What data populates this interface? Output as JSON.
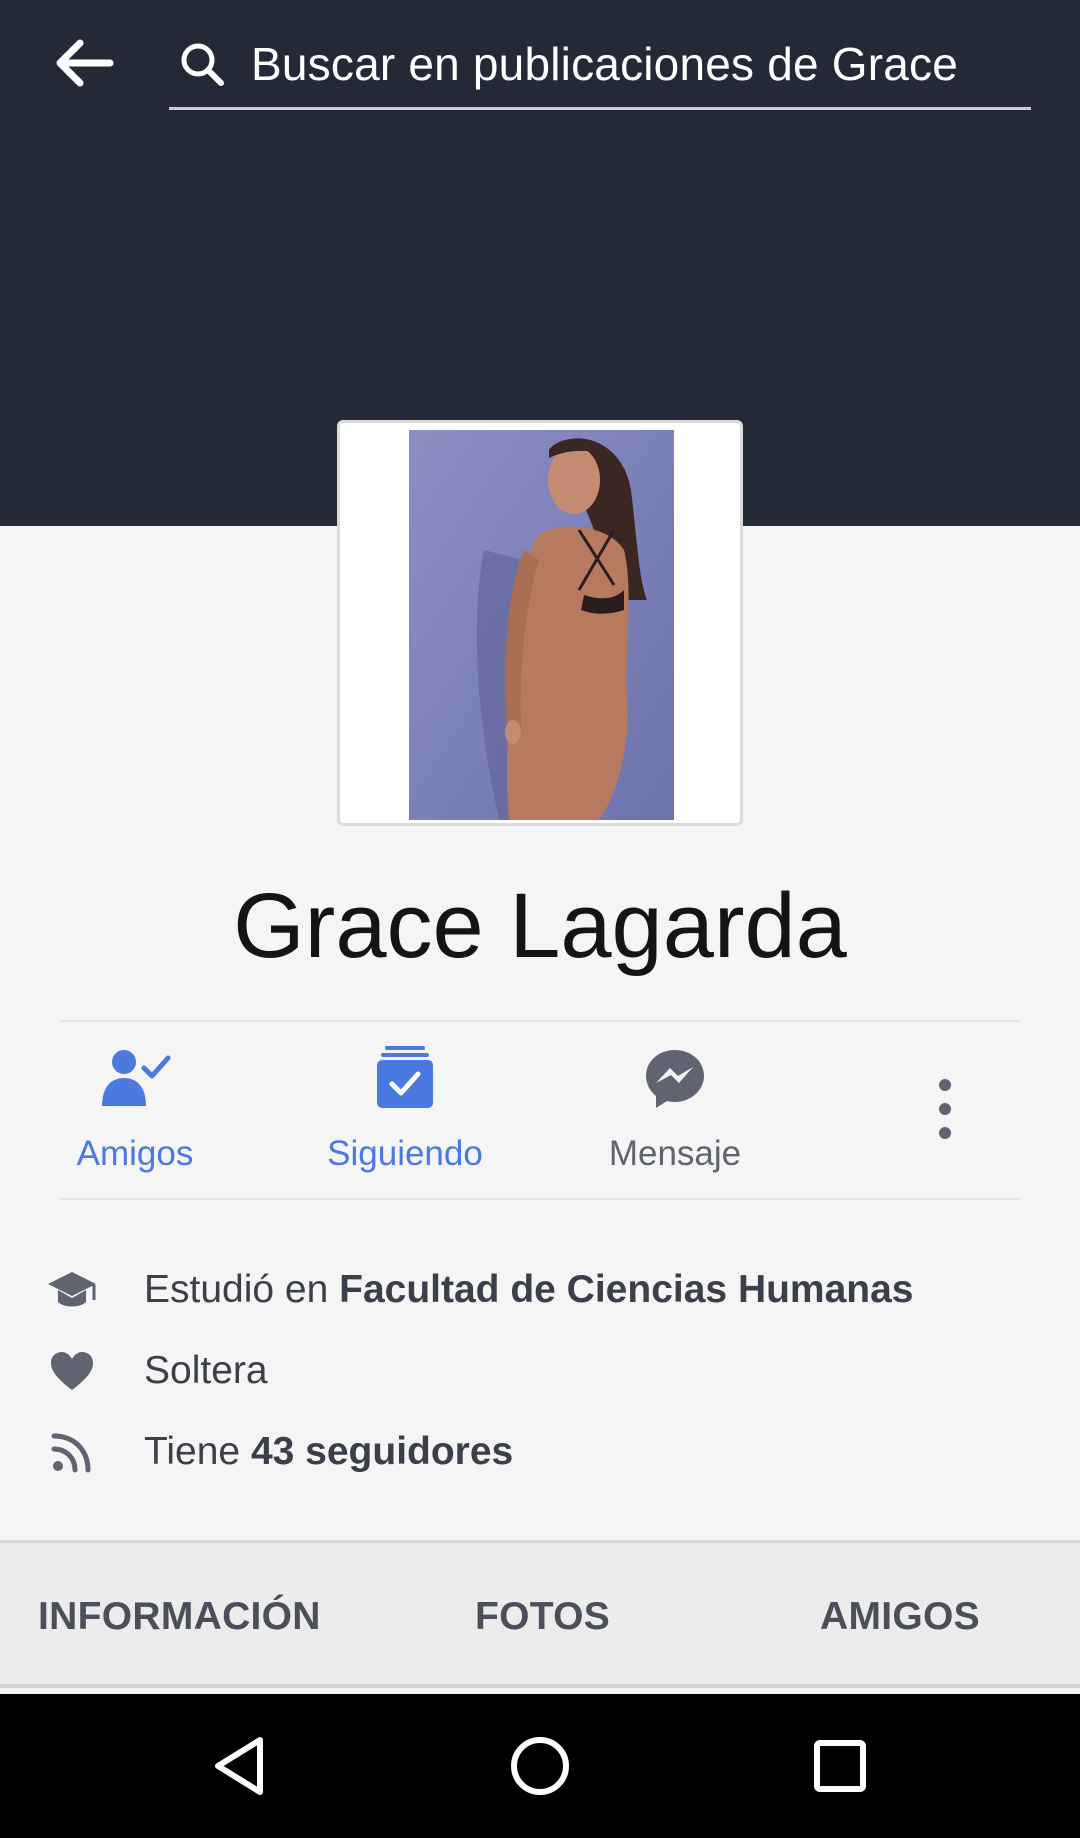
{
  "search": {
    "placeholder": "Buscar en publicaciones de Grace"
  },
  "profile": {
    "name": "Grace Lagarda"
  },
  "actions": {
    "friends": "Amigos",
    "following": "Siguiendo",
    "message": "Mensaje"
  },
  "info": {
    "education_prefix": "Estudió en ",
    "education_place": "Facultad de Ciencias Humanas",
    "relationship": "Soltera",
    "followers_prefix": "Tiene ",
    "followers_count": "43 seguidores"
  },
  "tabs": [
    "INFORMACIÓN",
    "FOTOS",
    "AMIGOS"
  ],
  "colors": {
    "header_bg": "#232937",
    "accent_blue": "#4a79e0",
    "icon_grey": "#5f6470"
  },
  "icons": {
    "back": "arrow-left-icon",
    "search": "search-icon",
    "friends": "person-check-icon",
    "following": "check-square-icon",
    "message": "messenger-icon",
    "more": "vertical-dots-icon",
    "education": "graduation-cap-icon",
    "relationship": "heart-icon",
    "followers": "rss-icon"
  }
}
